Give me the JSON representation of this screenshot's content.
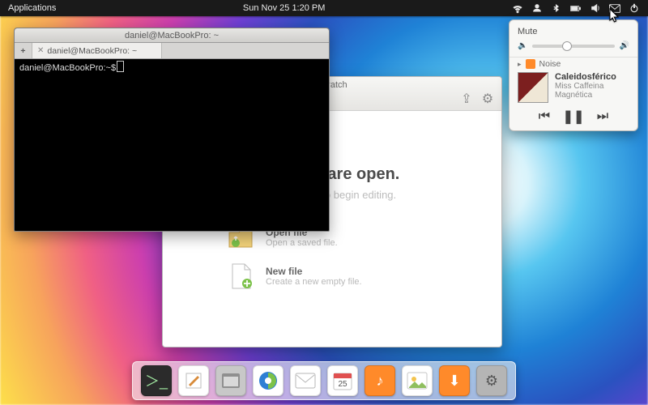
{
  "colors": {
    "panel": "#1a1a1a",
    "accent_orange": "#ff8a2a"
  },
  "topbar": {
    "applications": "Applications",
    "datetime": "Sun Nov 25  1:20 PM",
    "icons": [
      "wifi",
      "user",
      "bluetooth",
      "battery",
      "sound",
      "mail",
      "power"
    ]
  },
  "terminal": {
    "title": "daniel@MacBookPro: ~",
    "tab_label": "daniel@MacBookPro: ~",
    "prompt": "daniel@MacBookPro:~$"
  },
  "scratch": {
    "title": "Scratch",
    "heading": "No files are open.",
    "subheading": "Open a file to begin editing.",
    "actions": [
      {
        "title": "Open file",
        "subtitle": "Open a saved file."
      },
      {
        "title": "New file",
        "subtitle": "Create a new empty file."
      }
    ]
  },
  "sound_popover": {
    "mute_label": "Mute",
    "volume_percent": 42,
    "player_app": "Noise",
    "track": "Caleidosférico",
    "artist": "Miss Caffeina",
    "album": "Magnética",
    "state": "paused"
  },
  "dock": {
    "items": [
      "terminal",
      "text-editor",
      "files",
      "web-browser",
      "mail",
      "calendar",
      "music",
      "photos",
      "app-store",
      "settings"
    ]
  }
}
